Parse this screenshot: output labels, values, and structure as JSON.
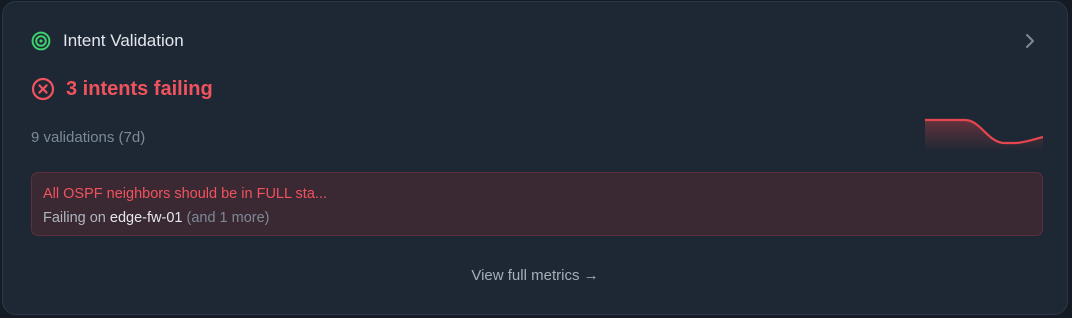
{
  "header": {
    "title": "Intent Validation",
    "icon": "target-icon",
    "accent_color": "#3ecf6e"
  },
  "status": {
    "icon": "x-circle-icon",
    "text": "3 intents failing",
    "color": "#f0535e"
  },
  "summary": {
    "validations": "9 validations (7d)"
  },
  "sparkline": {
    "color": "#e5454f",
    "values": [
      1,
      1,
      1,
      1,
      0.5,
      0,
      0,
      0.2
    ]
  },
  "alert": {
    "title": "All OSPF neighbors should be in FULL sta...",
    "prefix": "Failing on",
    "device": "edge-fw-01",
    "more": "(and 1 more)"
  },
  "footer": {
    "link_label": "View full metrics →"
  }
}
